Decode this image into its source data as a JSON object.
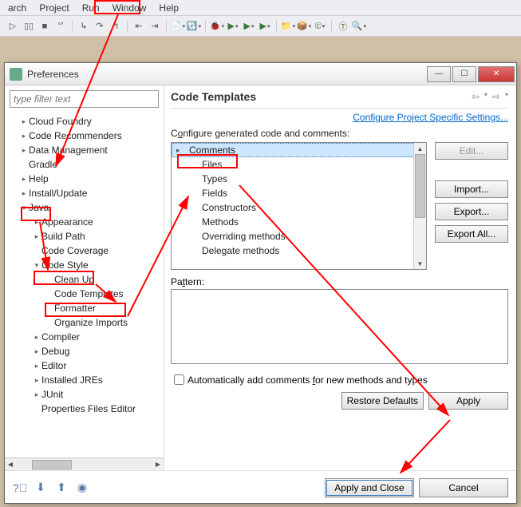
{
  "menubar": [
    "arch",
    "Project",
    "Run",
    "Window",
    "Help"
  ],
  "dialog": {
    "title": "Preferences",
    "filter_placeholder": "type filter text"
  },
  "tree": [
    {
      "label": "Cloud Foundry",
      "lvl": 1,
      "tw": "▸"
    },
    {
      "label": "Code Recommenders",
      "lvl": 1,
      "tw": "▸"
    },
    {
      "label": "Data Management",
      "lvl": 1,
      "tw": "▸"
    },
    {
      "label": "Gradle",
      "lvl": 1,
      "tw": ""
    },
    {
      "label": "Help",
      "lvl": 1,
      "tw": "▸"
    },
    {
      "label": "Install/Update",
      "lvl": 1,
      "tw": "▸"
    },
    {
      "label": "Java",
      "lvl": 1,
      "tw": "▾"
    },
    {
      "label": "Appearance",
      "lvl": 2,
      "tw": "▸"
    },
    {
      "label": "Build Path",
      "lvl": 2,
      "tw": "▸"
    },
    {
      "label": "Code Coverage",
      "lvl": 2,
      "tw": ""
    },
    {
      "label": "Code Style",
      "lvl": 2,
      "tw": "▾"
    },
    {
      "label": "Clean Up",
      "lvl": 3,
      "tw": ""
    },
    {
      "label": "Code Templates",
      "lvl": 3,
      "tw": ""
    },
    {
      "label": "Formatter",
      "lvl": 3,
      "tw": ""
    },
    {
      "label": "Organize Imports",
      "lvl": 3,
      "tw": ""
    },
    {
      "label": "Compiler",
      "lvl": 2,
      "tw": "▸"
    },
    {
      "label": "Debug",
      "lvl": 2,
      "tw": "▸"
    },
    {
      "label": "Editor",
      "lvl": 2,
      "tw": "▸"
    },
    {
      "label": "Installed JREs",
      "lvl": 2,
      "tw": "▸"
    },
    {
      "label": "JUnit",
      "lvl": 2,
      "tw": "▸"
    },
    {
      "label": "Properties Files Editor",
      "lvl": 2,
      "tw": ""
    }
  ],
  "right": {
    "heading": "Code Templates",
    "link": "Configure Project Specific Settings...",
    "config_label_pre": "C",
    "config_label_u": "o",
    "config_label_post": "nfigure generated code and comments:",
    "list": [
      {
        "label": "Comments",
        "parent": true,
        "selected": true
      },
      {
        "label": "Files",
        "child": true
      },
      {
        "label": "Types",
        "child": true
      },
      {
        "label": "Fields",
        "child": true
      },
      {
        "label": "Constructors",
        "child": true
      },
      {
        "label": "Methods",
        "child": true
      },
      {
        "label": "Overriding methods",
        "child": true
      },
      {
        "label": "Delegate methods",
        "child": true
      }
    ],
    "buttons": {
      "edit": "Edit...",
      "import": "Import...",
      "export": "Export...",
      "export_all": "Export All..."
    },
    "pattern_label_pre": "Pa",
    "pattern_label_u": "t",
    "pattern_label_post": "tern:",
    "checkbox_pre": "Automatically add comments ",
    "checkbox_u": "f",
    "checkbox_post": "or new methods and types",
    "restore": "Restore Defaults",
    "apply": "Apply",
    "apply_close": "Apply and Close",
    "cancel": "Cancel"
  }
}
